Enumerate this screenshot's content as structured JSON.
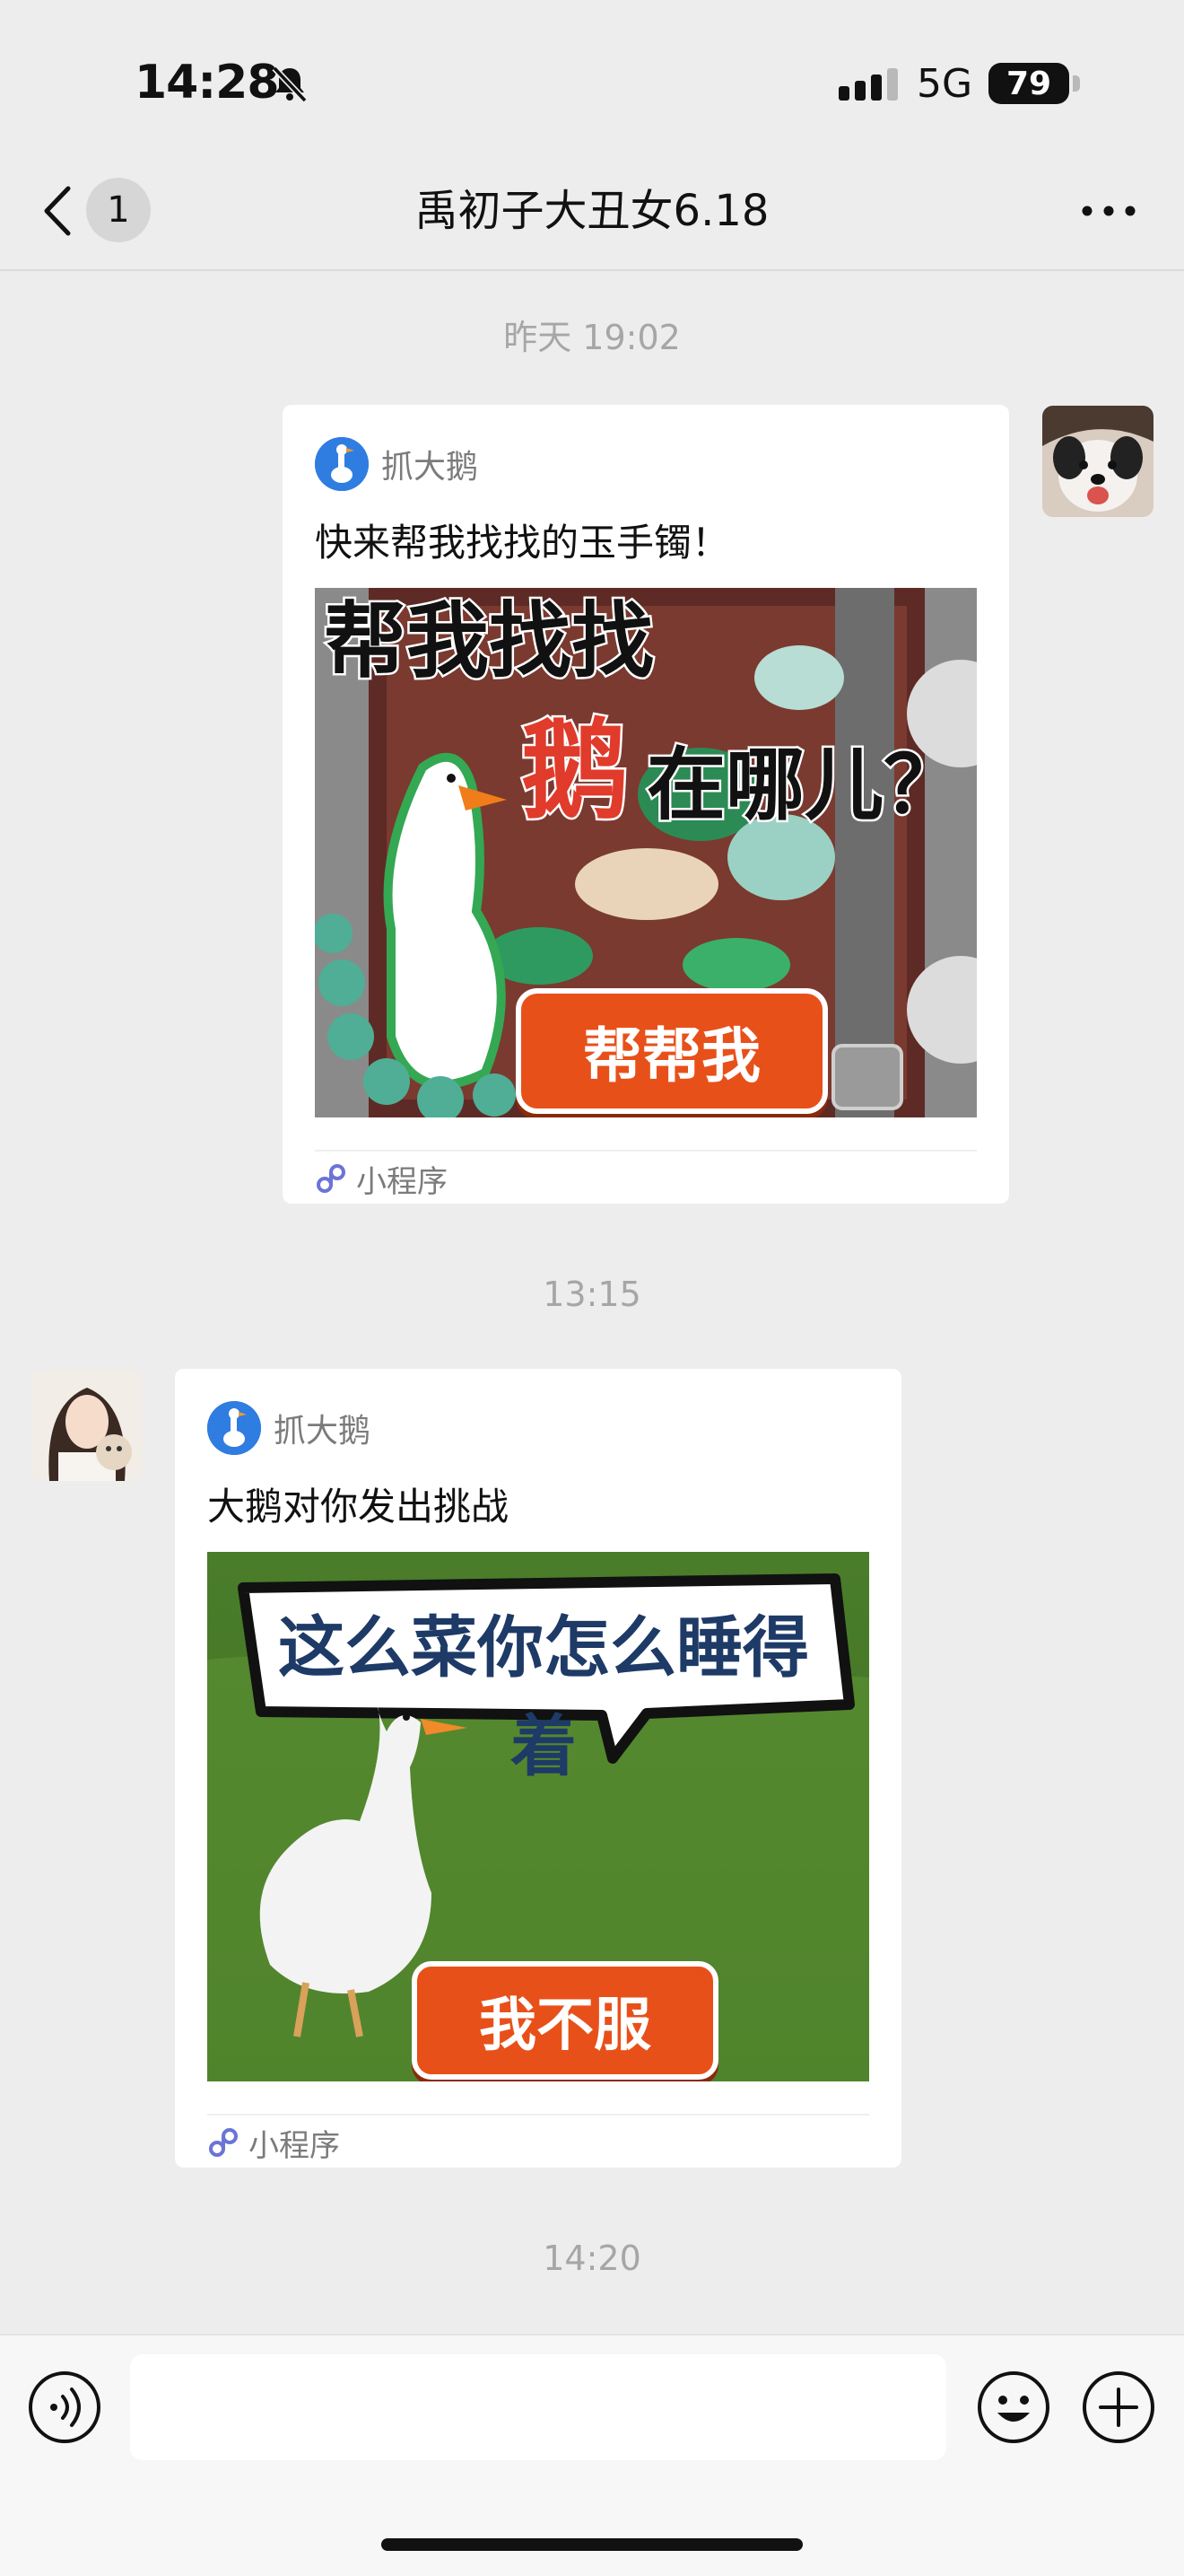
{
  "status_bar": {
    "time": "14:28",
    "network": "5G",
    "battery": "79"
  },
  "header": {
    "unread_count": "1",
    "title": "禹初子大丑女6.18"
  },
  "messages": [
    {
      "timestamp": "昨天 19:02",
      "sender": "self",
      "app_name": "抓大鹅",
      "description": "快来帮我找找的玉手镯！",
      "image": {
        "headline_1": "帮我找找",
        "headline_2": "鹅",
        "headline_3": "在哪儿？",
        "button": "帮帮我"
      },
      "footer": "小程序"
    },
    {
      "timestamp": "13:15",
      "sender": "other",
      "app_name": "抓大鹅",
      "description": "大鹅对你发出挑战",
      "image": {
        "bubble_text": "这么菜你怎么睡得着",
        "button": "我不服"
      },
      "footer": "小程序"
    }
  ],
  "last_timestamp": "14:20",
  "input": {
    "value": "",
    "placeholder": ""
  },
  "icons": {
    "mute": "bell-slash-icon",
    "signal": "signal-bars-icon",
    "back": "chevron-left-icon",
    "more": "more-dots-icon",
    "mini_program": "mini-program-link-icon",
    "voice": "voice-icon",
    "emoji": "emoji-icon",
    "plus": "plus-icon"
  },
  "colors": {
    "background": "#ededed",
    "card": "#ffffff",
    "timestamp": "#a6a6a6",
    "game_orange": "#e8501a",
    "app_logo_blue": "#2f7de1"
  }
}
